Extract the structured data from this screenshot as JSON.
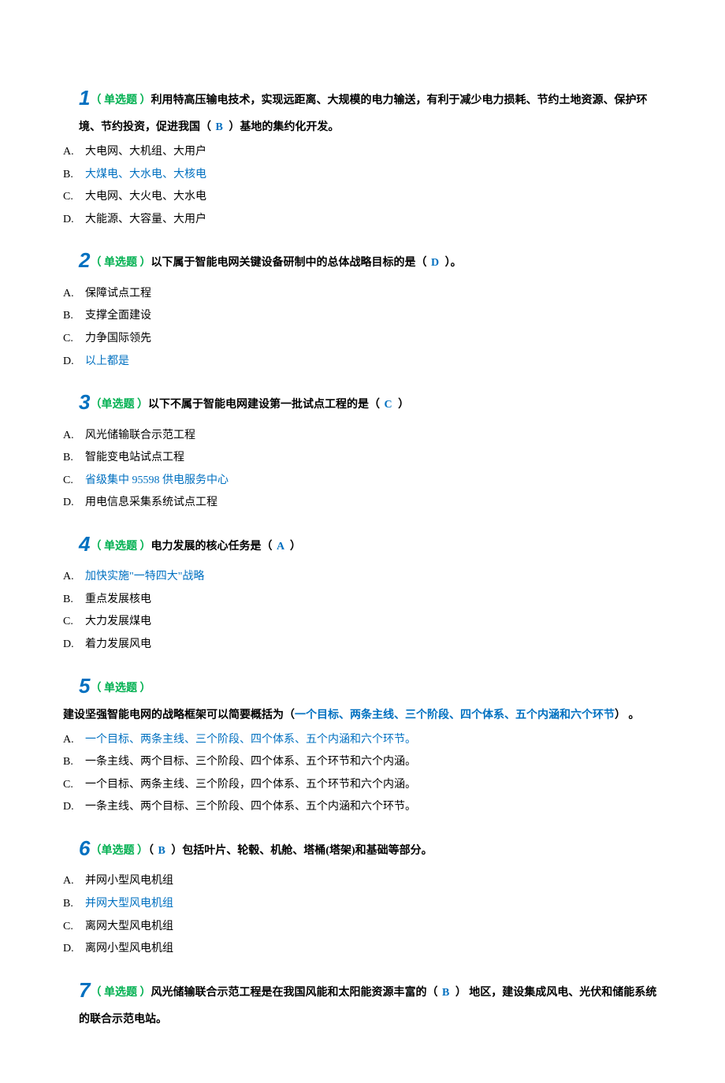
{
  "questions": [
    {
      "num": "1",
      "type": "（ 单选题 ）",
      "stem_pre": "利用特高压输电技术，实现远距离、大规模的电力输送，有利于减少电力损耗、节约土地资源、保护环境、节约投资，促进我国（",
      "answer_letter": "  B  ",
      "stem_post": "）基地的集约化开发。",
      "options": [
        {
          "label": "A.",
          "text": "大电网、大机组、大用户",
          "correct": false
        },
        {
          "label": "B.",
          "text": "大煤电、大水电、大核电",
          "correct": true
        },
        {
          "label": "C.",
          "text": "大电网、大火电、大水电",
          "correct": false
        },
        {
          "label": "D.",
          "text": "大能源、大容量、大用户",
          "correct": false
        }
      ]
    },
    {
      "num": "2",
      "type": "（ 单选题 ）",
      "stem_pre": "以下属于智能电网关键设备研制中的总体战略目标的是（",
      "answer_letter": "   D   ",
      "stem_post": "）。",
      "options": [
        {
          "label": "A.",
          "text": "保障试点工程",
          "correct": false
        },
        {
          "label": "B.",
          "text": "支撑全面建设",
          "correct": false
        },
        {
          "label": "C.",
          "text": "力争国际领先",
          "correct": false
        },
        {
          "label": "D.",
          "text": "以上都是",
          "correct": true
        }
      ]
    },
    {
      "num": "3",
      "type": "（单选题 ）",
      "stem_pre": "以下不属于智能电网建设第一批试点工程的是（",
      "answer_letter": "   C   ",
      "stem_post": "）",
      "options": [
        {
          "label": "A.",
          "text": "风光储输联合示范工程",
          "correct": false
        },
        {
          "label": "B.",
          "text": "智能变电站试点工程",
          "correct": false
        },
        {
          "label": "C.",
          "text": "省级集中 95598 供电服务中心",
          "correct": true
        },
        {
          "label": "D.",
          "text": "用电信息采集系统试点工程",
          "correct": false
        }
      ]
    },
    {
      "num": "4",
      "type": "（ 单选题 ）",
      "stem_pre": "电力发展的核心任务是（",
      "answer_letter": "  A   ",
      "stem_post": "）",
      "options": [
        {
          "label": "A.",
          "text": "加快实施\"一特四大\"战略",
          "correct": true
        },
        {
          "label": "B.",
          "text": "重点发展核电",
          "correct": false
        },
        {
          "label": "C.",
          "text": "大力发展煤电",
          "correct": false
        },
        {
          "label": "D.",
          "text": "着力发展风电",
          "correct": false
        }
      ]
    },
    {
      "num": "5",
      "type": "（ 单选题 ）",
      "stem_line2_pre": "建设坚强智能电网的战略框架可以简要概括为（",
      "stem_line2_highlight": "一个目标、两条主线、三个阶段、四个体系、五个内涵和六个环节",
      "stem_line2_post": "） 。",
      "options": [
        {
          "label": "A.",
          "text": "一个目标、两条主线、三个阶段、四个体系、五个内涵和六个环节。",
          "correct": true
        },
        {
          "label": "B.",
          "text": "一条主线、两个目标、三个阶段、四个体系、五个环节和六个内涵。",
          "correct": false
        },
        {
          "label": "C.",
          "text": "一个目标、两条主线、三个阶段，四个体系、五个环节和六个内涵。",
          "correct": false
        },
        {
          "label": "D.",
          "text": "一条主线、两个目标、三个阶段、四个体系、五个内涵和六个环节。",
          "correct": false
        }
      ]
    },
    {
      "num": "6",
      "type": "（单选题 ）",
      "stem_pre": "（",
      "answer_letter": "  B  ",
      "stem_post": "）包括叶片、轮毂、机舱、塔桶(塔架)和基础等部分。",
      "options": [
        {
          "label": "A.",
          "text": "并网小型风电机组",
          "correct": false
        },
        {
          "label": "B.",
          "text": "并网大型风电机组",
          "correct": true
        },
        {
          "label": "C.",
          "text": "离网大型风电机组",
          "correct": false
        },
        {
          "label": "D.",
          "text": "离网小型风电机组",
          "correct": false
        }
      ]
    },
    {
      "num": "7",
      "type": "（ 单选题 ）",
      "stem_pre": "风光储输联合示范工程是在我国风能和太阳能资源丰富的（",
      "answer_letter": "  B   ",
      "stem_post": "） 地区，建设集成风电、光伏和储能系统的联合示范电站。",
      "options": []
    }
  ]
}
